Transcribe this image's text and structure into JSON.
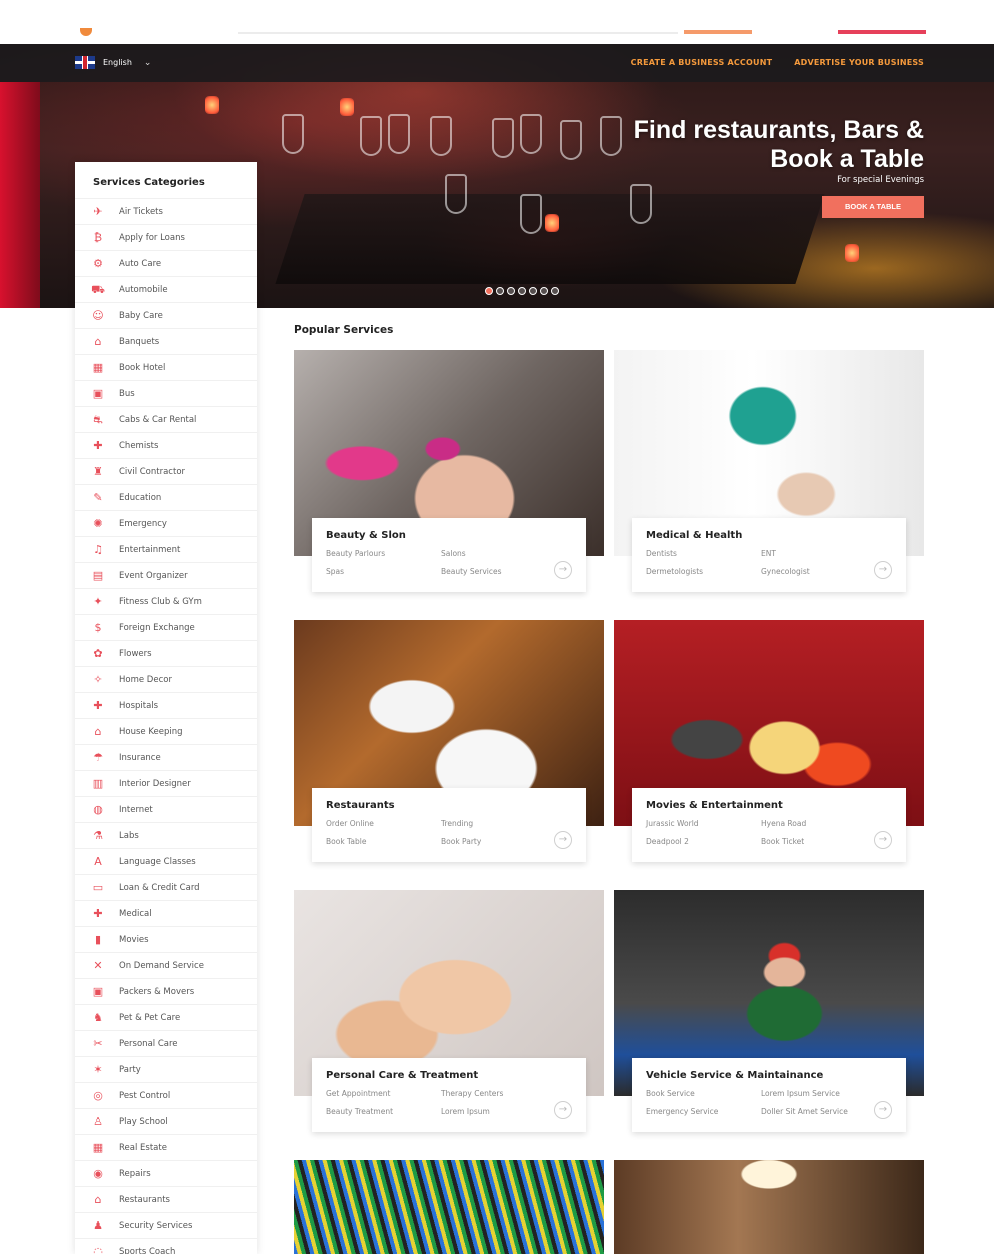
{
  "header": {
    "language": "English",
    "nav_links": [
      "CREATE A BUSINESS ACCOUNT",
      "ADVERTISE YOUR BUSINESS"
    ]
  },
  "hero": {
    "title_line1": "Find restaurants, Bars &",
    "title_line2": "Book a Table",
    "subtitle": "For special Evenings",
    "button": "BOOK A TABLE",
    "slide_count": 7,
    "active_slide": 1
  },
  "sidebar": {
    "title": "Services Categories",
    "items": [
      {
        "label": "Air Tickets",
        "icon": "✈"
      },
      {
        "label": "Apply for Loans",
        "icon": "₿"
      },
      {
        "label": "Auto Care",
        "icon": "⚙"
      },
      {
        "label": "Automobile",
        "icon": "⛟"
      },
      {
        "label": "Baby Care",
        "icon": "☺"
      },
      {
        "label": "Banquets",
        "icon": "⌂"
      },
      {
        "label": "Book Hotel",
        "icon": "▦"
      },
      {
        "label": "Bus",
        "icon": "▣"
      },
      {
        "label": "Cabs & Car Rental",
        "icon": "⛐"
      },
      {
        "label": "Chemists",
        "icon": "✚"
      },
      {
        "label": "Civil Contractor",
        "icon": "♜"
      },
      {
        "label": "Education",
        "icon": "✎"
      },
      {
        "label": "Emergency",
        "icon": "✺"
      },
      {
        "label": "Entertainment",
        "icon": "♫"
      },
      {
        "label": "Event Organizer",
        "icon": "▤"
      },
      {
        "label": "Fitness Club & GYm",
        "icon": "✦"
      },
      {
        "label": "Foreign Exchange",
        "icon": "$"
      },
      {
        "label": "Flowers",
        "icon": "✿"
      },
      {
        "label": "Home Decor",
        "icon": "✧"
      },
      {
        "label": "Hospitals",
        "icon": "✚"
      },
      {
        "label": "House Keeping",
        "icon": "⌂"
      },
      {
        "label": "Insurance",
        "icon": "☂"
      },
      {
        "label": "Interior Designer",
        "icon": "▥"
      },
      {
        "label": "Internet",
        "icon": "◍"
      },
      {
        "label": "Labs",
        "icon": "⚗"
      },
      {
        "label": "Language Classes",
        "icon": "A"
      },
      {
        "label": "Loan & Credit Card",
        "icon": "▭"
      },
      {
        "label": "Medical",
        "icon": "✚"
      },
      {
        "label": "Movies",
        "icon": "▮"
      },
      {
        "label": "On Demand Service",
        "icon": "✕"
      },
      {
        "label": "Packers & Movers",
        "icon": "▣"
      },
      {
        "label": "Pet & Pet Care",
        "icon": "♞"
      },
      {
        "label": "Personal Care",
        "icon": "✂"
      },
      {
        "label": "Party",
        "icon": "✶"
      },
      {
        "label": "Pest Control",
        "icon": "◎"
      },
      {
        "label": "Play School",
        "icon": "♙"
      },
      {
        "label": "Real Estate",
        "icon": "▦"
      },
      {
        "label": "Repairs",
        "icon": "◉"
      },
      {
        "label": "Restaurants",
        "icon": "⌂"
      },
      {
        "label": "Security Services",
        "icon": "♟"
      },
      {
        "label": "Sports Coach",
        "icon": "◌"
      }
    ]
  },
  "popular": {
    "title": "Popular Services",
    "cards": [
      {
        "title": "Beauty & Slon",
        "links": [
          "Beauty Parlours",
          "Salons",
          "Spas",
          "Beauty Services"
        ]
      },
      {
        "title": "Medical & Health",
        "links": [
          "Dentists",
          "ENT",
          "Dermetologists",
          "Gynecologist"
        ]
      },
      {
        "title": "Restaurants",
        "links": [
          "Order Online",
          "Trending",
          "Book Table",
          "Book Party"
        ]
      },
      {
        "title": "Movies & Entertainment",
        "links": [
          "Jurassic World",
          "Hyena Road",
          "Deadpool 2",
          "Book Ticket"
        ]
      },
      {
        "title": "Personal Care & Treatment",
        "links": [
          "Get Appointment",
          "Therapy Centers",
          "Beauty Treatment",
          "Lorem Ipsum"
        ]
      },
      {
        "title": "Vehicle Service & Maintainance",
        "links": [
          "Book Service",
          "Lorem Ipsum Service",
          "Emergency Service",
          "Doller Sit Amet Service"
        ]
      }
    ]
  },
  "colors": {
    "accent": "#f1705e",
    "nav_link": "#f59a3c",
    "icon": "#e8505b"
  }
}
